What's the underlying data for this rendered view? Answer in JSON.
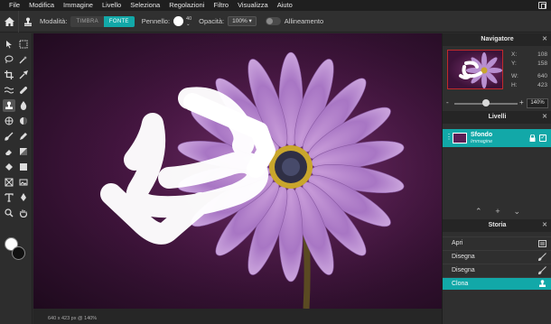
{
  "menu": [
    "File",
    "Modifica",
    "Immagine",
    "Livello",
    "Seleziona",
    "Regolazioni",
    "Filtro",
    "Visualizza",
    "Aiuto"
  ],
  "options": {
    "mode_label": "Modalità:",
    "mode_options": [
      "TIMBRA",
      "FONTE"
    ],
    "mode_selected": "FONTE",
    "brush_label": "Pennello:",
    "brush_size": "40",
    "opacity_label": "Opacità:",
    "opacity_value": "100% ▾",
    "align_label": "Allineamento"
  },
  "status": {
    "text": "640 x 423 px @ 140%"
  },
  "navigator": {
    "title": "Navigatore",
    "x_label": "X:",
    "x": "108",
    "y_label": "Y:",
    "y": "158",
    "w_label": "W:",
    "w": "640",
    "h_label": "H:",
    "h": "423",
    "zoom_minus": "-",
    "zoom_plus": "+",
    "zoom": "140%",
    "zoom_level": 0.5
  },
  "layers": {
    "title": "Livelli",
    "items": [
      {
        "name": "Sfondo",
        "sub": "Immagine"
      }
    ]
  },
  "history": {
    "title": "Storia",
    "items": [
      "Apri",
      "Disegna",
      "Disegna",
      "Clona"
    ],
    "selected_index": 3
  },
  "colors": {
    "accent": "#12a8a8",
    "foreground": "#ffffff",
    "background": "#111111"
  }
}
